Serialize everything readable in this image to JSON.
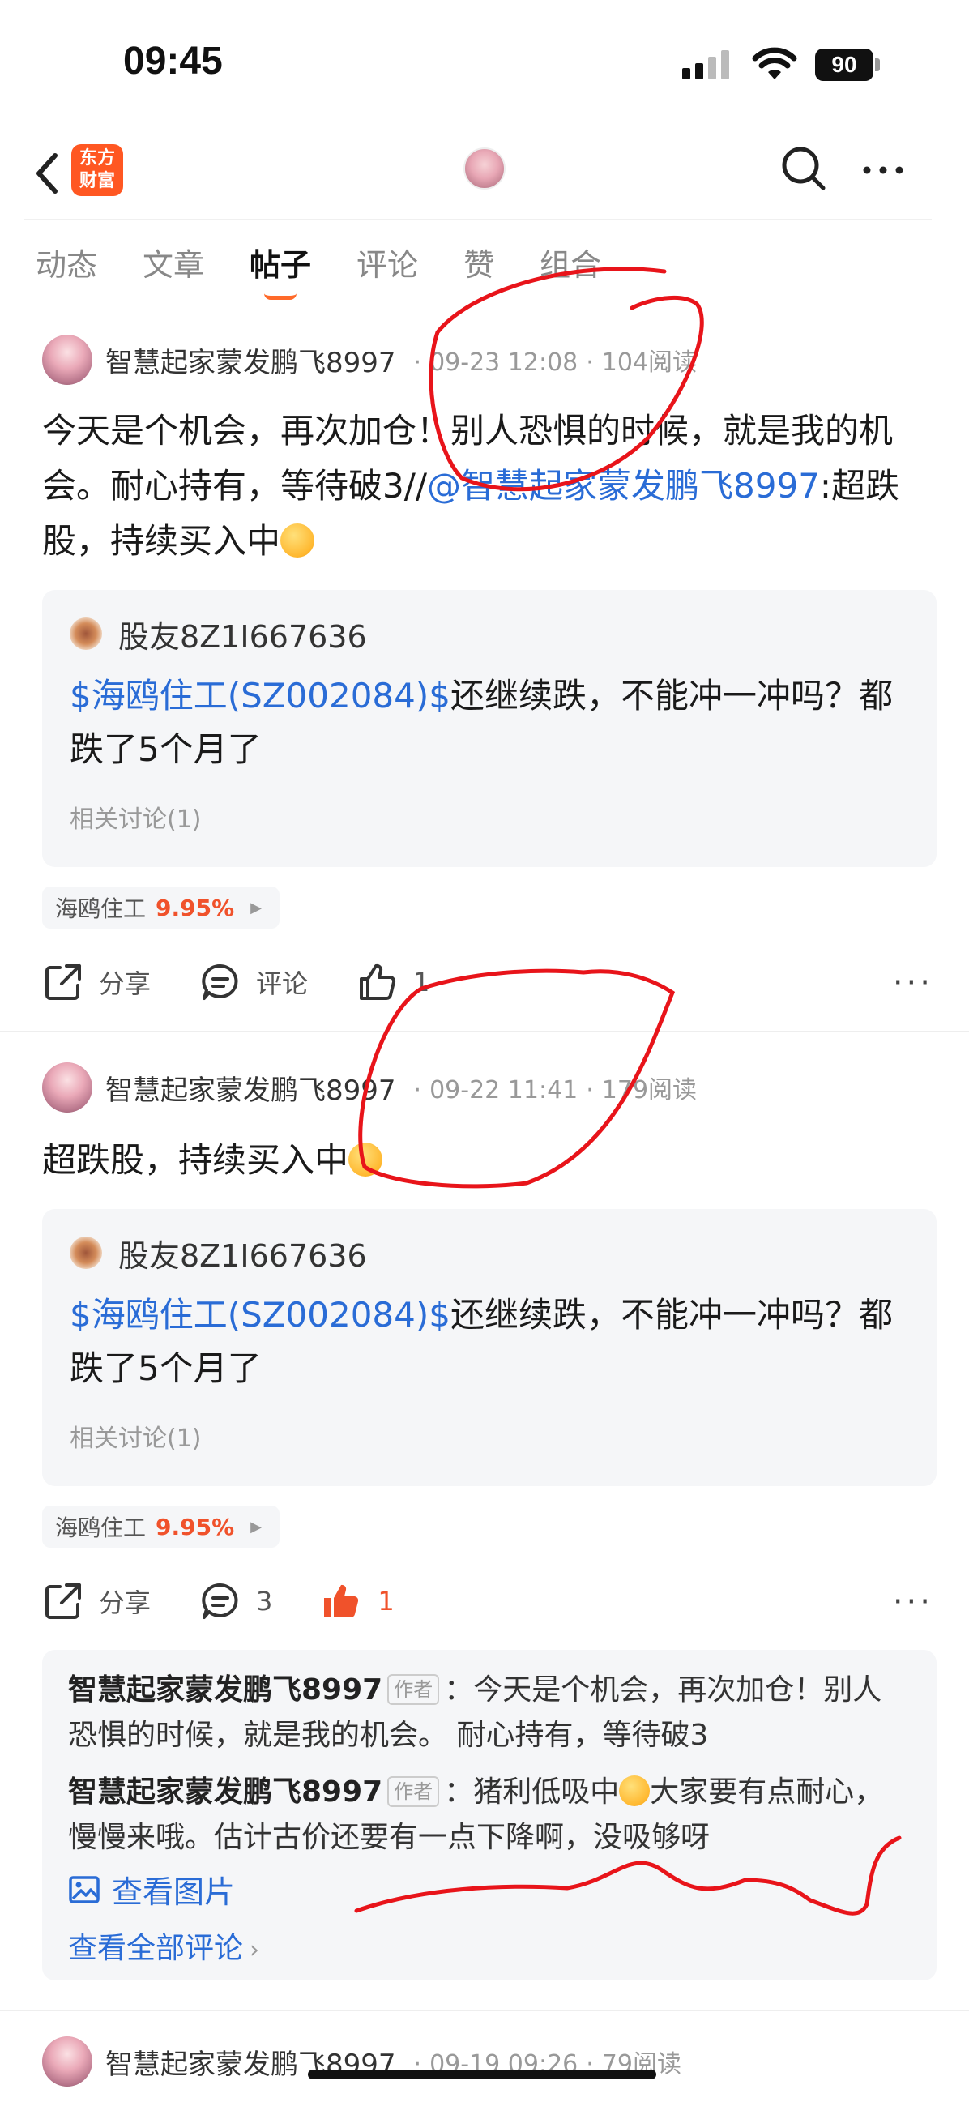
{
  "status_bar": {
    "time": "09:45",
    "battery": "90"
  },
  "header": {
    "logo_text_line1": "东方",
    "logo_text_line2": "财富",
    "back_icon": "chevron-left-icon",
    "search_icon": "search-icon",
    "more_icon": "more-horizontal-icon"
  },
  "tabs": [
    {
      "label": "动态",
      "active": false
    },
    {
      "label": "文章",
      "active": false
    },
    {
      "label": "帖子",
      "active": true
    },
    {
      "label": "评论",
      "active": false
    },
    {
      "label": "赞",
      "active": false
    },
    {
      "label": "组合",
      "active": false
    }
  ],
  "posts": [
    {
      "author": "智慧起家蒙发鹏飞8997",
      "date": "09-23 12:08",
      "reads": "104阅读",
      "body_text1": "今天是个机会，再次加仓！别人恐惧的时候，就是我的机会。耐心持有，等待破3//",
      "body_mention": "@智慧起家蒙发鹏飞8997",
      "body_text2": ":超跌股，持续买入中",
      "quote": {
        "user": "股友8Z1I667636",
        "stock_link": "$海鸥住工(SZ002084)$",
        "text": "还继续跌，不能冲一冲吗？都跌了5个月了",
        "related": "相关讨论(1)"
      },
      "stock_tag": {
        "name": "海鸥住工",
        "change": "9.95%"
      },
      "actions": {
        "share": "分享",
        "comment": "评论",
        "like": "1"
      }
    },
    {
      "author": "智慧起家蒙发鹏飞8997",
      "date": "09-22 11:41",
      "reads": "179阅读",
      "body_text": "超跌股，持续买入中",
      "quote": {
        "user": "股友8Z1I667636",
        "stock_link": "$海鸥住工(SZ002084)$",
        "text": "还继续跌，不能冲一冲吗？都跌了5个月了",
        "related": "相关讨论(1)"
      },
      "stock_tag": {
        "name": "海鸥住工",
        "change": "9.95%"
      },
      "actions": {
        "share": "分享",
        "comment": "3",
        "like": "1"
      },
      "comments": [
        {
          "name": "智慧起家蒙发鹏飞8997",
          "badge": "作者",
          "text": "：今天是个机会，再次加仓！别人恐惧的时候，就是我的机会。 耐心持有，等待破3"
        },
        {
          "name": "智慧起家蒙发鹏飞8997",
          "badge": "作者",
          "text_before": "：猪利低吸中",
          "text_after": "大家要有点耐心，慢慢来哦。估计古价还要有一点下降啊，没吸够呀"
        }
      ],
      "view_image": "查看图片",
      "view_all": "查看全部评论"
    },
    {
      "author": "智慧起家蒙发鹏飞8997",
      "date": "09-19 09:26",
      "reads": "79阅读"
    }
  ],
  "colors": {
    "accent": "#ff6a2a",
    "link": "#2a6cd6",
    "rise": "#f0522b",
    "annotation": "#e8141a"
  }
}
